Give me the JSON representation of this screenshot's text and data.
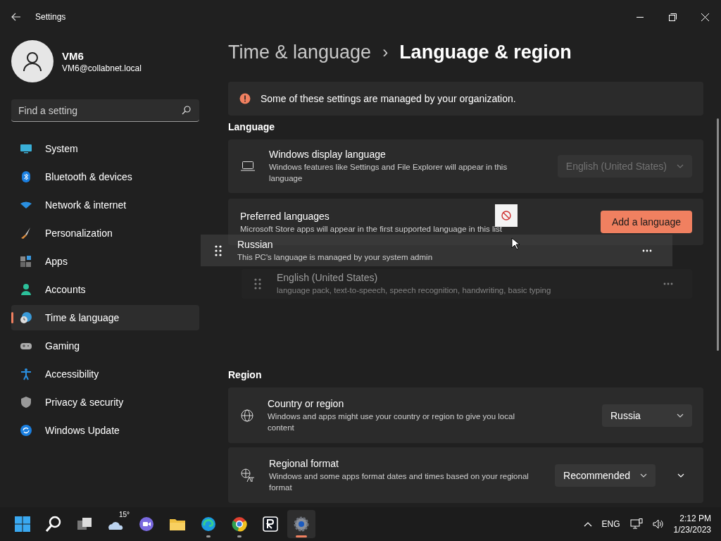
{
  "window": {
    "title": "Settings"
  },
  "profile": {
    "name": "VM6",
    "email": "VM6@collabnet.local"
  },
  "search": {
    "placeholder": "Find a setting"
  },
  "nav": [
    {
      "kind": "system",
      "label": "System",
      "selected": false
    },
    {
      "kind": "bluetooth",
      "label": "Bluetooth & devices",
      "selected": false
    },
    {
      "kind": "network",
      "label": "Network & internet",
      "selected": false
    },
    {
      "kind": "personalization",
      "label": "Personalization",
      "selected": false
    },
    {
      "kind": "apps",
      "label": "Apps",
      "selected": false
    },
    {
      "kind": "accounts",
      "label": "Accounts",
      "selected": false
    },
    {
      "kind": "time",
      "label": "Time & language",
      "selected": true
    },
    {
      "kind": "gaming",
      "label": "Gaming",
      "selected": false
    },
    {
      "kind": "accessibility",
      "label": "Accessibility",
      "selected": false
    },
    {
      "kind": "privacy",
      "label": "Privacy & security",
      "selected": false
    },
    {
      "kind": "update",
      "label": "Windows Update",
      "selected": false
    }
  ],
  "breadcrumb": {
    "parent": "Time & language",
    "separator": "›",
    "current": "Language & region"
  },
  "banner": {
    "text": "Some of these settings are managed by your organization."
  },
  "language": {
    "heading": "Language",
    "display": {
      "title": "Windows display language",
      "description": "Windows features like Settings and File Explorer will appear in this language",
      "value": "English (United States)",
      "disabled": true
    },
    "preferred": {
      "title": "Preferred languages",
      "description": "Microsoft Store apps will appear in the first supported language in this list",
      "button": "Add a language"
    },
    "languages": [
      {
        "name": "English (United States)",
        "details": "language pack, text-to-speech, speech recognition, handwriting, basic typing",
        "dimmed": true
      }
    ],
    "dragged": {
      "name": "Russian",
      "details": "This PC's language is managed by your system admin"
    }
  },
  "region": {
    "heading": "Region",
    "cards": [
      {
        "kind": "globe",
        "title": "Country or region",
        "description": "Windows and apps might use your country or region to give you local content",
        "value": "Russia",
        "expandable": false
      },
      {
        "kind": "format",
        "title": "Regional format",
        "description": "Windows and some apps format dates and times based on your regional format",
        "value": "Recommended",
        "expandable": true
      }
    ]
  },
  "taskbar": {
    "apps": [
      {
        "kind": "start",
        "running": false,
        "selected": false
      },
      {
        "kind": "search",
        "running": false,
        "selected": false
      },
      {
        "kind": "taskview",
        "running": false,
        "selected": false
      },
      {
        "kind": "widgets",
        "badge": "15°",
        "running": false,
        "selected": false
      },
      {
        "kind": "chat",
        "running": false,
        "selected": false
      },
      {
        "kind": "explorer",
        "running": false,
        "selected": false
      },
      {
        "kind": "edge",
        "running": true,
        "selected": false
      },
      {
        "kind": "chrome",
        "running": true,
        "selected": false
      },
      {
        "kind": "rapp",
        "running": false,
        "selected": false
      },
      {
        "kind": "settings",
        "running": true,
        "selected": true
      }
    ],
    "language": "ENG",
    "time": "2:12 PM",
    "date": "1/23/2023"
  }
}
